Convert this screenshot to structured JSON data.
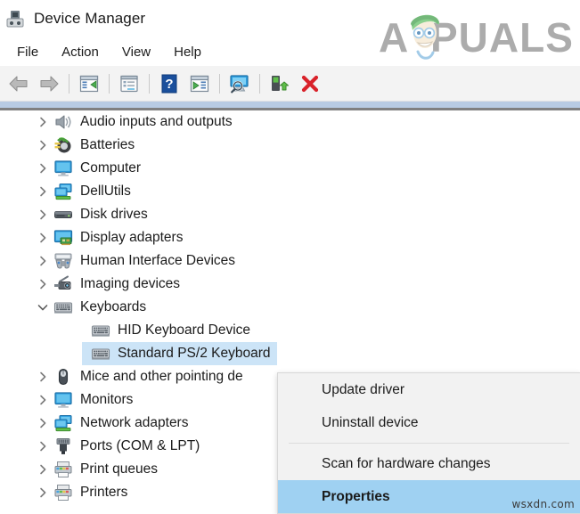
{
  "window": {
    "title": "Device Manager",
    "icon": "device-manager-icon"
  },
  "menubar": {
    "items": [
      {
        "label": "File"
      },
      {
        "label": "Action"
      },
      {
        "label": "View"
      },
      {
        "label": "Help"
      }
    ]
  },
  "toolbar": {
    "buttons": [
      {
        "name": "back-arrow-icon",
        "label": "Back"
      },
      {
        "name": "forward-arrow-icon",
        "label": "Forward"
      },
      {
        "name": "show-hide-console-tree-icon",
        "label": "Show/Hide Console Tree"
      },
      {
        "name": "properties-icon",
        "label": "Properties"
      },
      {
        "name": "help-icon",
        "label": "Help"
      },
      {
        "name": "update-driver-icon",
        "label": "Update Driver Software"
      },
      {
        "name": "scan-hardware-changes-icon",
        "label": "Scan for hardware changes"
      },
      {
        "name": "enable-device-icon",
        "label": "Enable device"
      },
      {
        "name": "uninstall-device-icon",
        "label": "Uninstall device"
      }
    ]
  },
  "tree": {
    "items": [
      {
        "label": "Audio inputs and outputs",
        "icon": "speaker-icon",
        "indent": 0,
        "state": "collapsed",
        "selected": false
      },
      {
        "label": "Batteries",
        "icon": "battery-icon",
        "indent": 0,
        "state": "collapsed",
        "selected": false
      },
      {
        "label": "Computer",
        "icon": "monitor-icon",
        "indent": 0,
        "state": "collapsed",
        "selected": false
      },
      {
        "label": "DellUtils",
        "icon": "network-icon",
        "indent": 0,
        "state": "collapsed",
        "selected": false
      },
      {
        "label": "Disk drives",
        "icon": "disk-drive-icon",
        "indent": 0,
        "state": "collapsed",
        "selected": false
      },
      {
        "label": "Display adapters",
        "icon": "display-adapter-icon",
        "indent": 0,
        "state": "collapsed",
        "selected": false
      },
      {
        "label": "Human Interface Devices",
        "icon": "hid-icon",
        "indent": 0,
        "state": "collapsed",
        "selected": false
      },
      {
        "label": "Imaging devices",
        "icon": "camera-icon",
        "indent": 0,
        "state": "collapsed",
        "selected": false
      },
      {
        "label": "Keyboards",
        "icon": "keyboard-icon",
        "indent": 0,
        "state": "expanded",
        "selected": false
      },
      {
        "label": "HID Keyboard Device",
        "icon": "keyboard-icon",
        "indent": 1,
        "state": "leaf",
        "selected": false
      },
      {
        "label": "Standard PS/2 Keyboard",
        "icon": "keyboard-icon",
        "indent": 1,
        "state": "leaf",
        "selected": true
      },
      {
        "label": "Mice and other pointing de",
        "icon": "mouse-icon",
        "indent": 0,
        "state": "collapsed",
        "selected": false
      },
      {
        "label": "Monitors",
        "icon": "monitor-icon",
        "indent": 0,
        "state": "collapsed",
        "selected": false
      },
      {
        "label": "Network adapters",
        "icon": "network-icon",
        "indent": 0,
        "state": "collapsed",
        "selected": false
      },
      {
        "label": "Ports (COM & LPT)",
        "icon": "port-icon",
        "indent": 0,
        "state": "collapsed",
        "selected": false
      },
      {
        "label": "Print queues",
        "icon": "printer-icon",
        "indent": 0,
        "state": "collapsed",
        "selected": false
      },
      {
        "label": "Printers",
        "icon": "printer-icon",
        "indent": 0,
        "state": "collapsed",
        "selected": false
      }
    ]
  },
  "context_menu": {
    "items": [
      {
        "label": "Update driver",
        "highlighted": false,
        "separator_after": false
      },
      {
        "label": "Uninstall device",
        "highlighted": false,
        "separator_after": true
      },
      {
        "label": "Scan for hardware changes",
        "highlighted": false,
        "separator_after": false
      },
      {
        "label": "Properties",
        "highlighted": true,
        "separator_after": false
      }
    ]
  },
  "watermarks": {
    "brand": "APPUALS",
    "site": "wsxdn.com"
  },
  "colors": {
    "selection_row": "#cce4f7",
    "menu_highlight": "#9fd1f2",
    "toolbar_bg": "#f3f3f3",
    "context_menu_bg": "#f2f2f2",
    "accent_band": "#b8cbe3"
  }
}
